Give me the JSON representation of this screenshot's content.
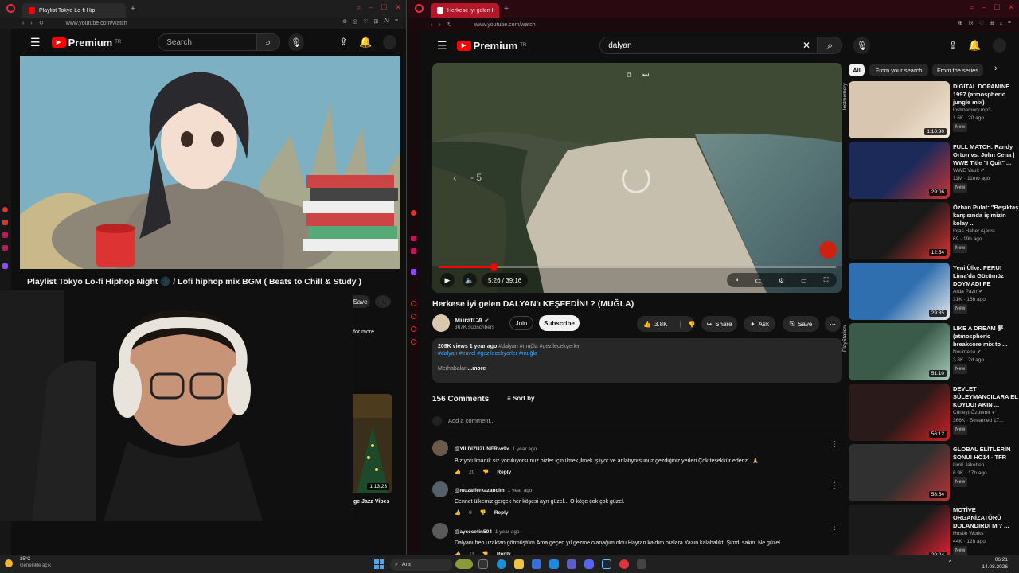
{
  "left": {
    "tab_title": "Playlist Tokyo Lo-fi Hip",
    "url": "www.youtube.com/watch",
    "search_placeholder": "Search",
    "logo": "Premium",
    "logo_region": "TR",
    "video_title": "Playlist Tokyo Lo-fi Hiphop Night 🌑 / Lofi hiphop mix BGM ( Beats to Chill & Study )",
    "save_label": "Save",
    "side_more": "for more",
    "side_duration": "1:13:23",
    "side_caption": "ge Jazz Vibes"
  },
  "right": {
    "tab_title": "Herkese iyi gelen DALYAN'",
    "url": "www.youtube.com/watch",
    "logo": "Premium",
    "logo_region": "TR",
    "search_value": "dalyan",
    "player": {
      "skip_label": "- 5",
      "time": "5:26 / 39:16",
      "progress": 0.138
    },
    "video_title": "Herkese iyi gelen DALYAN'ı KEŞFEDİN! ? (MUĞLA)",
    "channel": {
      "name": "MuratCA",
      "subs": "367K subscribers",
      "join": "Join",
      "subscribe": "Subscribe"
    },
    "actions": {
      "likes": "3.8K",
      "share": "Share",
      "ask": "Ask",
      "save": "Save"
    },
    "description": {
      "stats": "209K views  1 year ago",
      "tags1": "#dalyan #muğla #gezilecekyerler",
      "tags2": "#dalyan #travel #gezilecekyerler #muğla",
      "text": "Merhabalar",
      "more": "...more"
    },
    "comments": {
      "count": "156 Comments",
      "sort": "Sort by",
      "add": "Add a comment...",
      "items": [
        {
          "user": "@YILDIZUZUNER-w9x",
          "time": "1 year ago",
          "text": "Biz yorulmadık siz yoruluyorsunuz bizler için ilmek,ilmek işliyor ve anlatıyorsunuz gezdiğiniz yerleri.Çok teşekkür ederiz...🙏",
          "likes": "20",
          "reply": "Reply"
        },
        {
          "user": "@muzafferkazancim",
          "time": "1 year ago",
          "text": "Cennet ülkemiz gerçek her köşesi ayrı güzel... O köşe çok çok güzel.",
          "likes": "9",
          "reply": "Reply"
        },
        {
          "user": "@aysecetin504",
          "time": "1 year ago",
          "text": "Dalyanı hep uzaktan görmüştüm.Ama geçen yıl gezme olanağım oldu.Hayran kaldım oralara.Yazın kalabalıktı.Şimdi sakin .Ne güzel.",
          "likes": "11",
          "reply": "Reply"
        }
      ]
    },
    "chips": [
      "All",
      "From your search",
      "From the series"
    ],
    "related": [
      {
        "title": "DIGITAL DOPAMINE 1997 (atmospheric jungle mix)",
        "channel": "lostmemory.mp3",
        "meta": "1.6K · 20 ago",
        "duration": "1:10:30",
        "side": "lostmemory"
      },
      {
        "title": "FULL MATCH: Randy Orton vs. John Cena | WWE Title \"I Quit\" ...",
        "channel": "WWE Vault ✔",
        "meta": "11M · 11mo ago",
        "duration": "29:06",
        "side": ""
      },
      {
        "title": "Özhan Pulat: \"Beşiktaş karşısında işimizin kolay ...",
        "channel": "İhlas Haber Ajansı",
        "meta": "69 · 19h ago",
        "duration": "12:54",
        "side": ""
      },
      {
        "title": "Yeni Ülke: PERU! Lima'da Gözümüz DOYMADI PE",
        "channel": "Arda Pazır ✔",
        "meta": "31K · 16h ago",
        "duration": "29:35",
        "side": ""
      },
      {
        "title": "LIKE A DREAM 夢 (atmospheric breakcore mix to ...",
        "channel": "Noumena ✔",
        "meta": "3.8K · 2d ago",
        "duration": "51:10",
        "side": "PlayStation"
      },
      {
        "title": "DEVLET SÜLEYMANCILARA EL KOYDU! AKIN ...",
        "channel": "Cüneyt Özdemir ✔",
        "meta": "366K · Streamed 17...",
        "duration": "56:12",
        "side": ""
      },
      {
        "title": "GLOBAL ELİTLERİN SONU! HO14 - TFR",
        "channel": "İlimli Jakoben",
        "meta": "6.9K · 17h ago",
        "duration": "58:54",
        "side": ""
      },
      {
        "title": "MOTİVE ORGANİZATÖRÜ DOLANDIRDI MI? ...",
        "channel": "Hustle Works",
        "meta": "44K · 12h ago",
        "duration": "29:24",
        "side": ""
      }
    ],
    "new_badge": "New"
  },
  "taskbar": {
    "temp": "25°C",
    "weather": "Genellikle açık",
    "search": "Ara",
    "time": "06:21",
    "date": "14.08.2026"
  }
}
